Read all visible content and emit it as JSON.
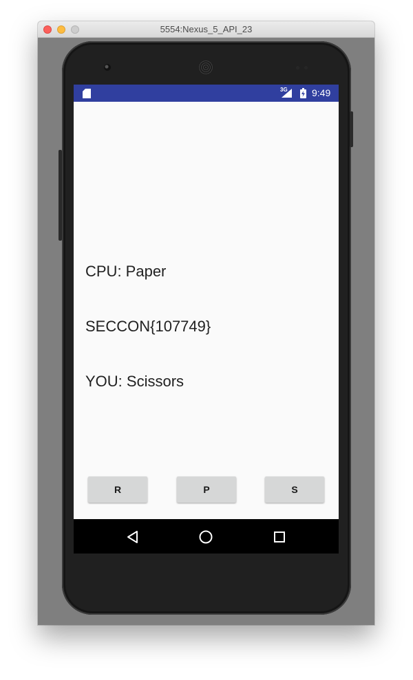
{
  "window": {
    "title": "5554:Nexus_5_API_23"
  },
  "statusbar": {
    "network": "3G",
    "time": "9:49",
    "color": "#303f9f"
  },
  "app": {
    "cpu_text": "CPU: Paper",
    "flag_text": "SECCON{107749}",
    "you_text": "YOU: Scissors",
    "buttons": [
      {
        "label": "R"
      },
      {
        "label": "P"
      },
      {
        "label": "S"
      }
    ]
  },
  "icons": {
    "statusbar": [
      "sd-card-icon",
      "signal-icon",
      "battery-icon"
    ],
    "navbar": [
      "back-icon",
      "home-icon",
      "recents-icon"
    ]
  }
}
